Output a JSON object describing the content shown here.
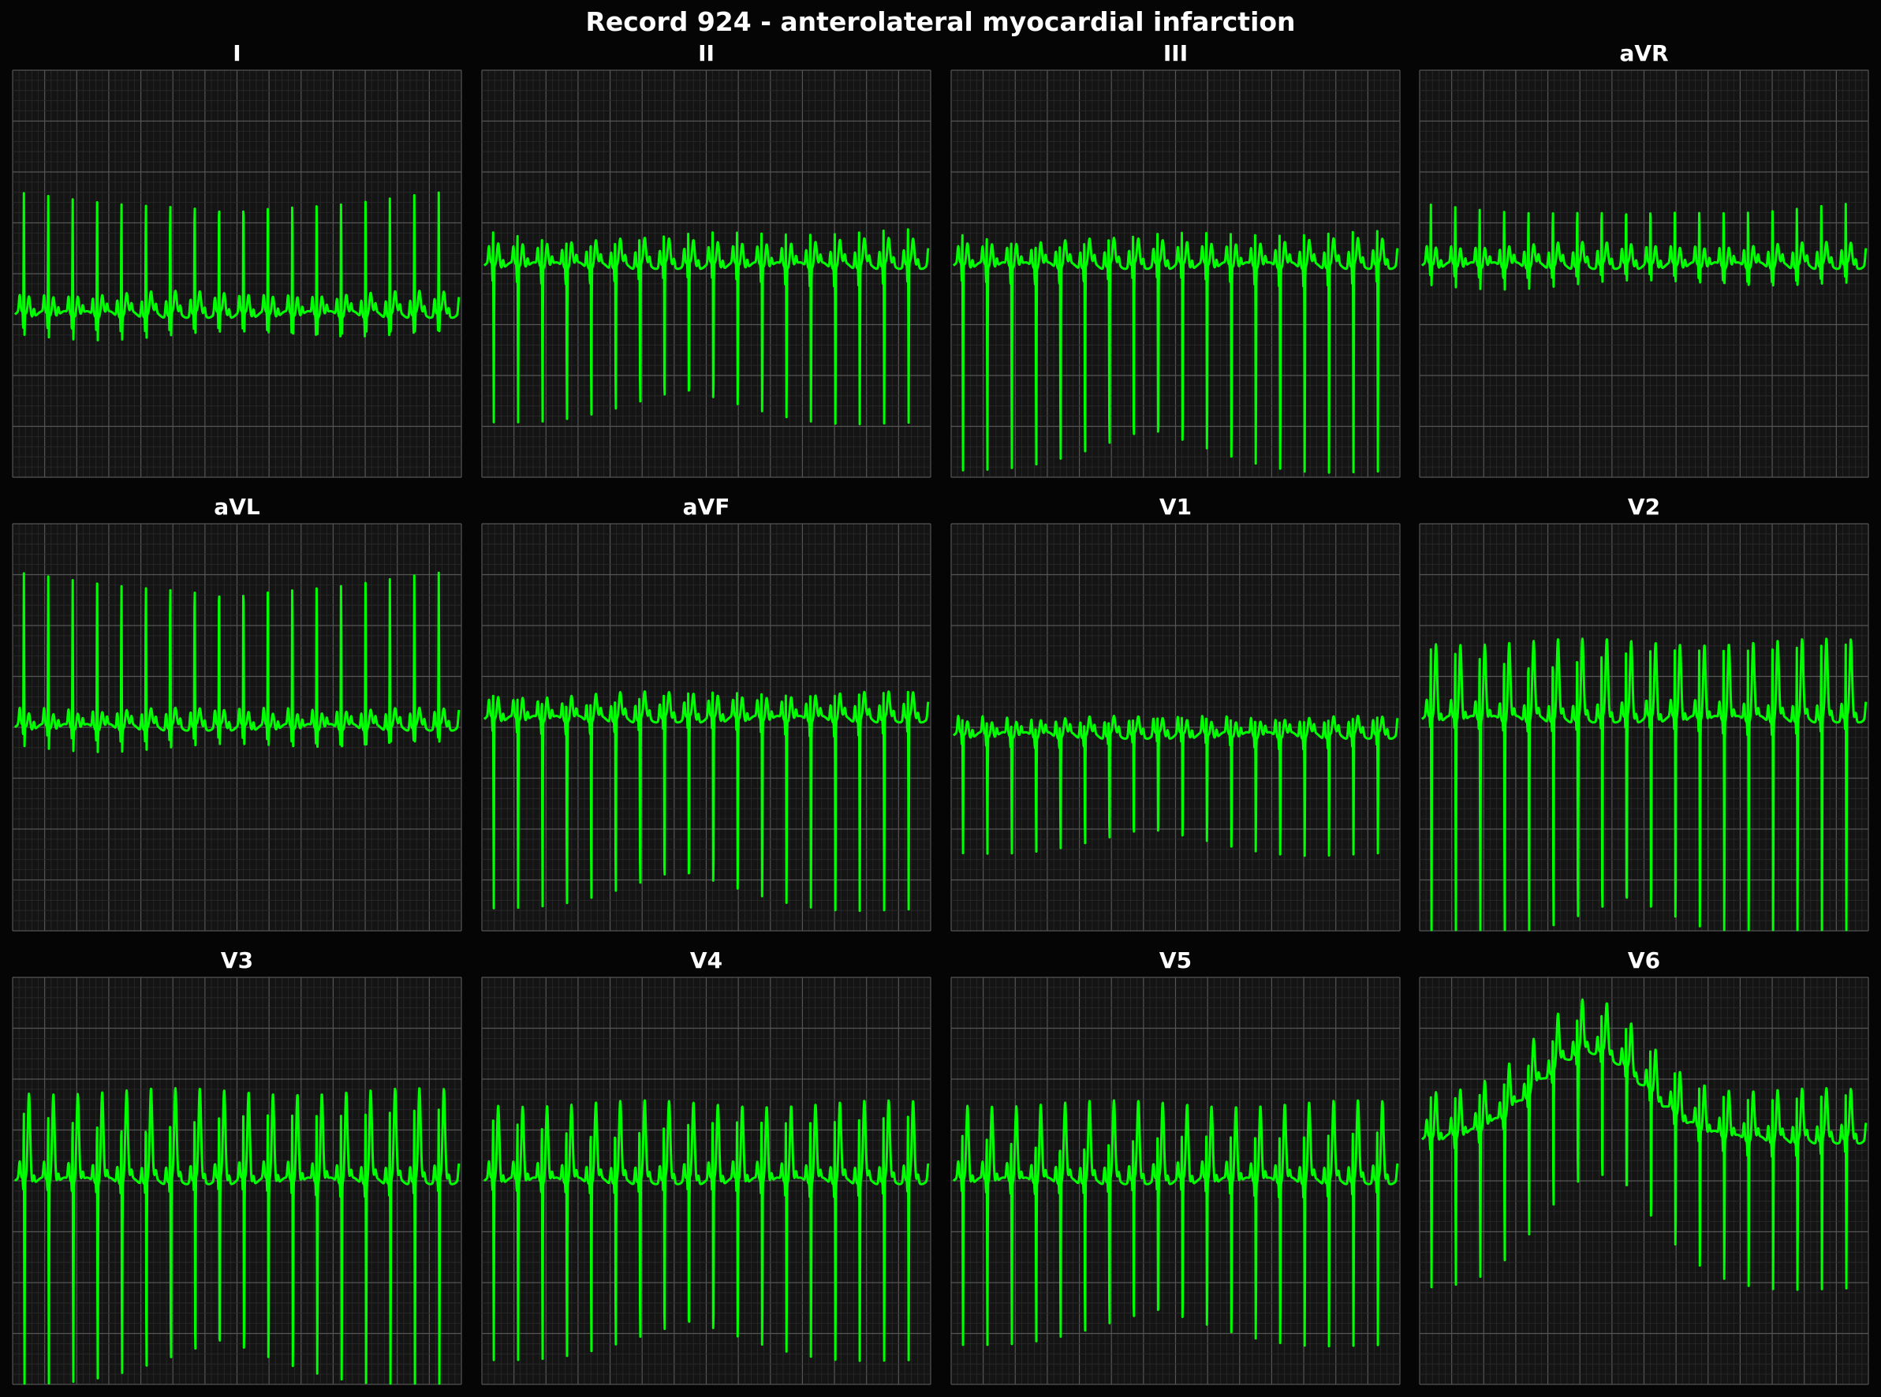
{
  "title": "Record 924 - anterolateral myocardial infarction",
  "colors": {
    "background": "#050505",
    "panel": "#141414",
    "grid_major": "#555555",
    "grid_minor": "#2a2a2a",
    "trace": "#00ff00",
    "text": "#ffffff"
  },
  "chart_data": {
    "type": "line",
    "layout": "3x4 grid of leads",
    "grid": true,
    "heart_rate_approx_bpm": 108,
    "beats_per_panel": 18,
    "leads": [
      {
        "name": "I",
        "baseline": 0.6,
        "r": 0.3,
        "q": 0.06,
        "s": 0.07,
        "t": 0.05
      },
      {
        "name": "II",
        "baseline": 0.48,
        "r": 0.1,
        "q": 0.05,
        "s": 0.4,
        "t": 0.06
      },
      {
        "name": "III",
        "baseline": 0.48,
        "r": 0.1,
        "q": 0.05,
        "s": 0.52,
        "t": 0.06
      },
      {
        "name": "aVR",
        "baseline": 0.48,
        "r": 0.15,
        "q": 0.04,
        "s": 0.06,
        "t": 0.05
      },
      {
        "name": "aVL",
        "baseline": 0.5,
        "r": 0.38,
        "q": 0.05,
        "s": 0.07,
        "t": 0.04
      },
      {
        "name": "aVF",
        "baseline": 0.48,
        "r": 0.08,
        "q": 0.04,
        "s": 0.48,
        "t": 0.06
      },
      {
        "name": "V1",
        "baseline": 0.52,
        "r": 0.05,
        "q": 0.03,
        "s": 0.3,
        "t": 0.04
      },
      {
        "name": "V2",
        "baseline": 0.48,
        "r": 0.2,
        "q": 0.04,
        "s": 0.58,
        "t": 0.19
      },
      {
        "name": "V3",
        "baseline": 0.5,
        "r": 0.19,
        "q": 0.04,
        "s": 0.52,
        "t": 0.22
      },
      {
        "name": "V4",
        "baseline": 0.5,
        "r": 0.17,
        "q": 0.04,
        "s": 0.46,
        "t": 0.19
      },
      {
        "name": "V5",
        "baseline": 0.5,
        "r": 0.13,
        "q": 0.04,
        "s": 0.42,
        "t": 0.19
      },
      {
        "name": "V6",
        "baseline": 0.4,
        "r": 0.12,
        "q": 0.04,
        "s": 0.38,
        "t": 0.12
      }
    ]
  }
}
